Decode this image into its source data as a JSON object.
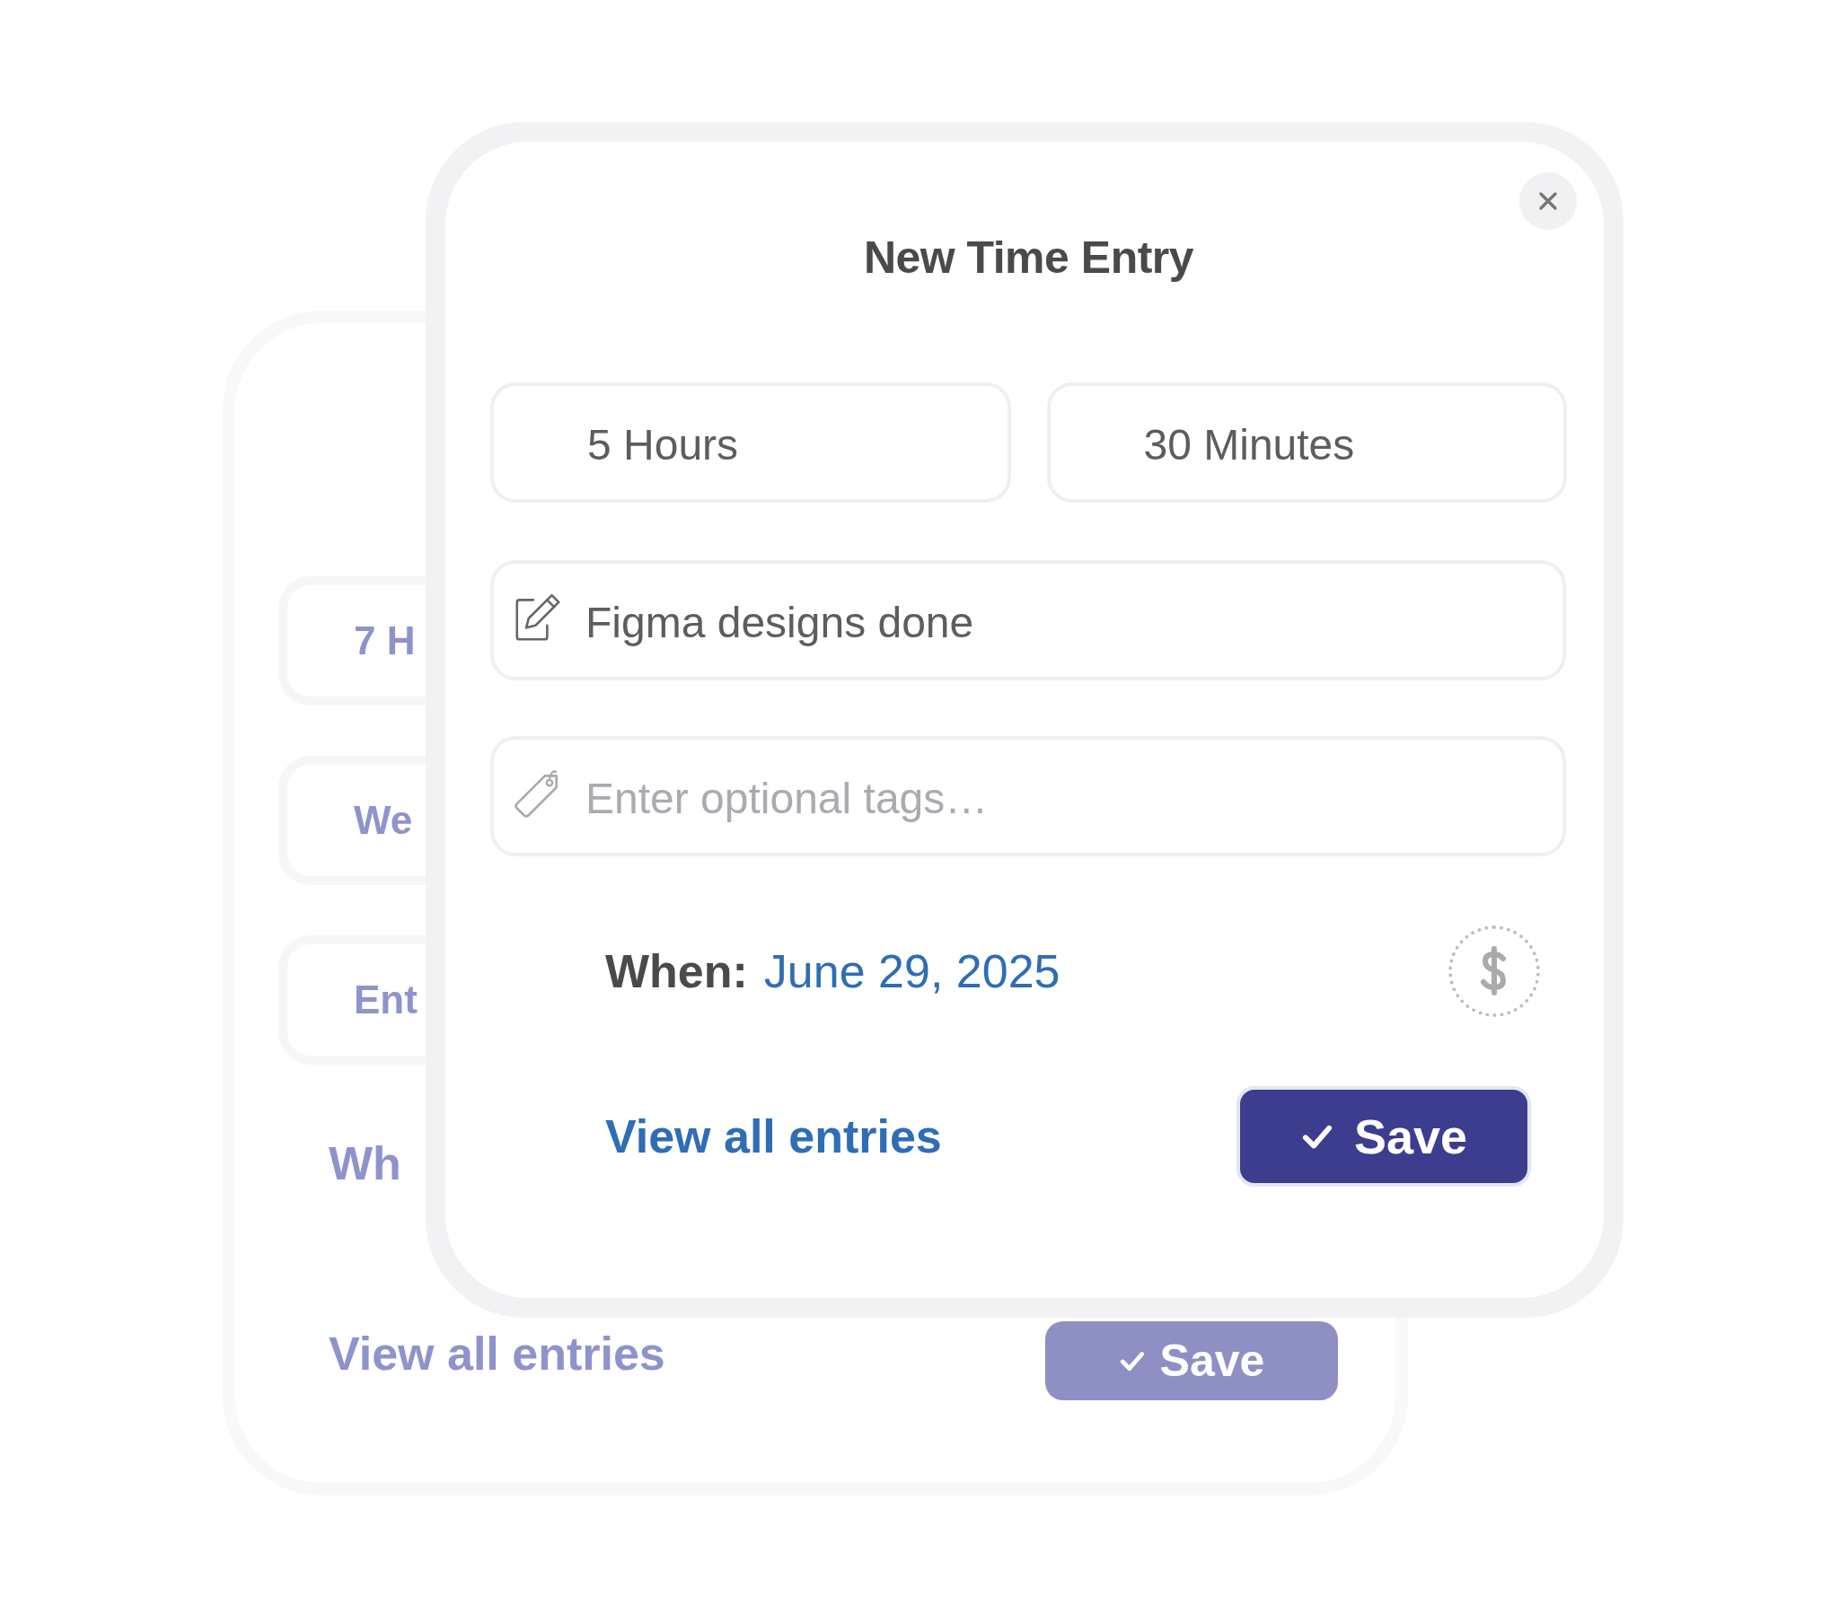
{
  "background_card": {
    "fields": [
      "7 H",
      "We",
      "Ent"
    ],
    "when_label": "Wh",
    "link": "View all entries",
    "button": "Save"
  },
  "dialog": {
    "title": "New Time Entry",
    "duration": [
      {
        "value": "5 Hours"
      },
      {
        "value": "30 Minutes"
      }
    ],
    "description": {
      "value": "Figma designs done"
    },
    "tags": {
      "placeholder": "Enter optional tags…"
    },
    "when": {
      "label": "When:",
      "value": "June 29, 2025"
    },
    "billable": false,
    "link": "View all entries",
    "save_button": "Save"
  }
}
